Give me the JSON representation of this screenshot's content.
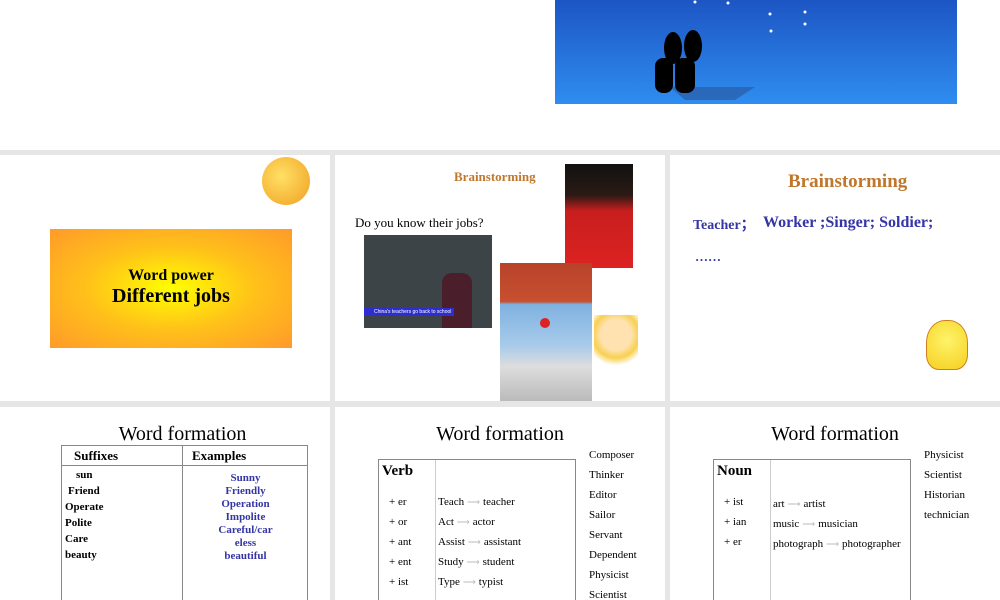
{
  "slide_top": {
    "image": "couple-under-stars-illustration"
  },
  "slide_title": {
    "line1": "Word power",
    "line2": "Different jobs",
    "decoration": "emoji-with-mirror"
  },
  "slide_brainstorm_photos": {
    "heading": "Brainstorming",
    "question": "Do you know their jobs?",
    "photo_caption": "China's teachers go back to school",
    "images": [
      "singer-photo",
      "teacher-photo",
      "worker-photo",
      "cartoon-girl"
    ]
  },
  "slide_brainstorm_answers": {
    "heading": "Brainstorming",
    "first": "Teacher；",
    "rest": "Worker ;Singer; Soldier;",
    "ellipsis": "……"
  },
  "slide_suffixes": {
    "title": "Word formation",
    "headers": [
      "Suffixes",
      "Examples"
    ],
    "words": [
      "sun",
      "Friend",
      "Operate",
      "Polite",
      "Care",
      "beauty"
    ],
    "examples": [
      "Sunny",
      "Friendly",
      "Operation",
      "Impolite",
      "Careful/car",
      "eless",
      "beautiful"
    ]
  },
  "slide_verb": {
    "title": "Word formation",
    "label": "Verb",
    "rows": [
      {
        "suffix": "+ er",
        "from": "Teach",
        "to": "teacher"
      },
      {
        "suffix": "+ or",
        "from": "Act",
        "to": "actor"
      },
      {
        "suffix": "+ ant",
        "from": "Assist",
        "to": "assistant"
      },
      {
        "suffix": "+ ent",
        "from": "Study",
        "to": "student"
      },
      {
        "suffix": "+ ist",
        "from": "Type",
        "to": "typist"
      }
    ],
    "side_list": [
      "Composer",
      "Thinker",
      "Editor",
      "Sailor",
      "Servant",
      "Dependent",
      "Physicist",
      "Scientist"
    ]
  },
  "slide_noun": {
    "title": "Word formation",
    "label": "Noun",
    "suffixes": [
      "+ ist",
      "+ ian",
      "+ er"
    ],
    "pairs": [
      {
        "from": "art",
        "to": "artist"
      },
      {
        "from": "music",
        "to": "musician"
      },
      {
        "from": "photograph",
        "to": "photographer"
      }
    ],
    "side_list": [
      "Physicist",
      "Scientist",
      "Historian",
      "technician"
    ],
    "arrow": "⟶"
  }
}
